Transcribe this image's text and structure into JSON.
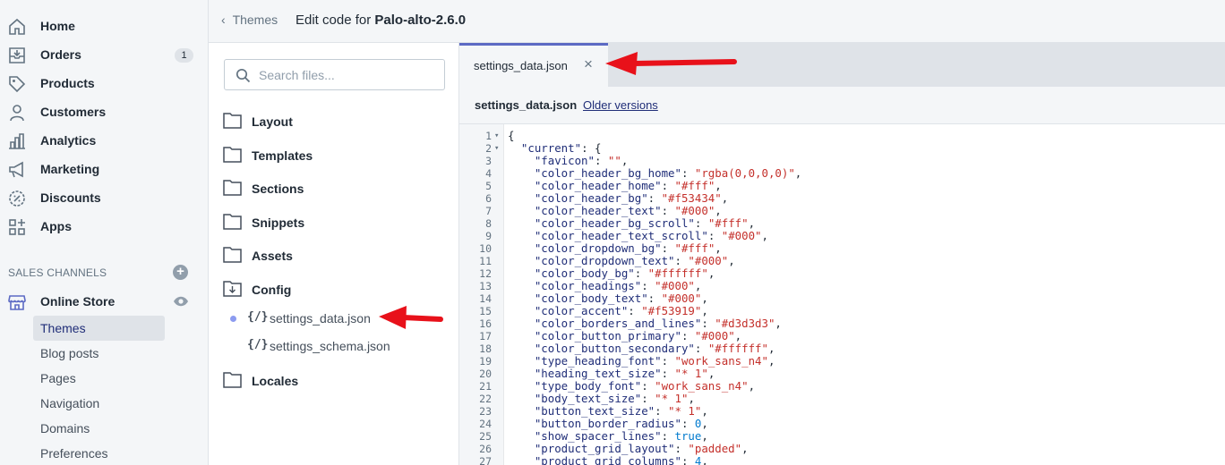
{
  "nav": {
    "items": [
      {
        "label": "Home",
        "icon": "home-icon"
      },
      {
        "label": "Orders",
        "icon": "orders-icon",
        "badge": "1"
      },
      {
        "label": "Products",
        "icon": "tag-icon"
      },
      {
        "label": "Customers",
        "icon": "person-icon"
      },
      {
        "label": "Analytics",
        "icon": "analytics-icon"
      },
      {
        "label": "Marketing",
        "icon": "megaphone-icon"
      },
      {
        "label": "Discounts",
        "icon": "discount-icon"
      },
      {
        "label": "Apps",
        "icon": "apps-icon"
      }
    ],
    "sales_channels_title": "SALES CHANNELS",
    "online_store_label": "Online Store",
    "sub_items": [
      "Themes",
      "Blog posts",
      "Pages",
      "Navigation",
      "Domains",
      "Preferences"
    ],
    "active_sub": "Themes"
  },
  "header": {
    "back_label": "Themes",
    "title_prefix": "Edit code for ",
    "theme_name": "Palo-alto-2.6.0"
  },
  "files": {
    "search_placeholder": "Search files...",
    "folders": [
      "Layout",
      "Templates",
      "Sections",
      "Snippets",
      "Assets",
      "Config",
      "Locales"
    ],
    "config_files": [
      "settings_data.json",
      "settings_schema.json"
    ],
    "code_icon": "{/}"
  },
  "editor": {
    "tab_label": "settings_data.json",
    "close_glyph": "×",
    "file_name": "settings_data.json",
    "older_versions": "Older versions",
    "lines": [
      "{",
      "  \"current\": {",
      "    \"favicon\": \"\",",
      "    \"color_header_bg_home\": \"rgba(0,0,0,0)\",",
      "    \"color_header_home\": \"#fff\",",
      "    \"color_header_bg\": \"#f53434\",",
      "    \"color_header_text\": \"#000\",",
      "    \"color_header_bg_scroll\": \"#fff\",",
      "    \"color_header_text_scroll\": \"#000\",",
      "    \"color_dropdown_bg\": \"#fff\",",
      "    \"color_dropdown_text\": \"#000\",",
      "    \"color_body_bg\": \"#ffffff\",",
      "    \"color_headings\": \"#000\",",
      "    \"color_body_text\": \"#000\",",
      "    \"color_accent\": \"#f53919\",",
      "    \"color_borders_and_lines\": \"#d3d3d3\",",
      "    \"color_button_primary\": \"#000\",",
      "    \"color_button_secondary\": \"#ffffff\",",
      "    \"type_heading_font\": \"work_sans_n4\",",
      "    \"heading_text_size\": \"* 1\",",
      "    \"type_body_font\": \"work_sans_n4\",",
      "    \"body_text_size\": \"* 1\",",
      "    \"button_text_size\": \"* 1\",",
      "    \"button_border_radius\": 0,",
      "    \"show_spacer_lines\": true,",
      "    \"product_grid_layout\": \"padded\",",
      "    \"product_grid_columns\": 4,"
    ]
  },
  "colors": {
    "accent": "#5c6ac4",
    "annotation_arrow": "#e8111a",
    "string": "#c4302b",
    "key": "#202e78"
  }
}
